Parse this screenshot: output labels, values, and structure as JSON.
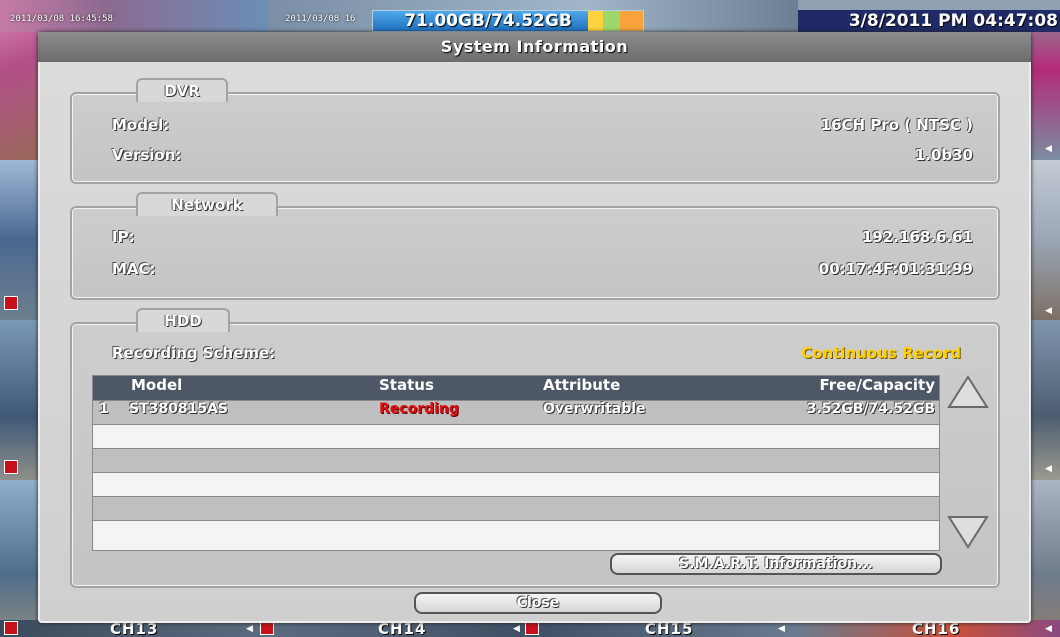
{
  "top_bar": {
    "hdd_usage": "71.00GB/74.52GB",
    "clock": "3/8/2011 PM 04:47:08",
    "cam_timestamps": [
      "2011/03/08 16:45:58",
      "2011/03/08 16"
    ]
  },
  "channels": [
    "CH13",
    "CH14",
    "CH15",
    "CH16"
  ],
  "dialog": {
    "title": "System Information",
    "dvr": {
      "section_label": "DVR",
      "model_label": "Model:",
      "model_value": "16CH Pro ( NTSC )",
      "version_label": "Version:",
      "version_value": "1.0b30"
    },
    "network": {
      "section_label": "Network",
      "ip_label": "IP:",
      "ip_value": "192.168.6.61",
      "mac_label": "MAC:",
      "mac_value": "00:17:4F:01:31:99"
    },
    "hdd": {
      "section_label": "HDD",
      "scheme_label": "Recording Scheme:",
      "scheme_value": "Continuous Record",
      "columns": [
        "Model",
        "Status",
        "Attribute",
        "Free/Capacity"
      ],
      "rows": [
        {
          "index": "1",
          "model": "ST380815AS",
          "status": "Recording",
          "attribute": "Overwritable",
          "capacity": "3.52GB/74.52GB"
        }
      ],
      "smart_button": "S.M.A.R.T. Information..."
    },
    "close_button": "Close"
  },
  "colors": {
    "status_recording": "#e01010",
    "scheme_value": "#ffd000",
    "title_bar": "#7a7a7a",
    "table_header": "#4d5766"
  }
}
